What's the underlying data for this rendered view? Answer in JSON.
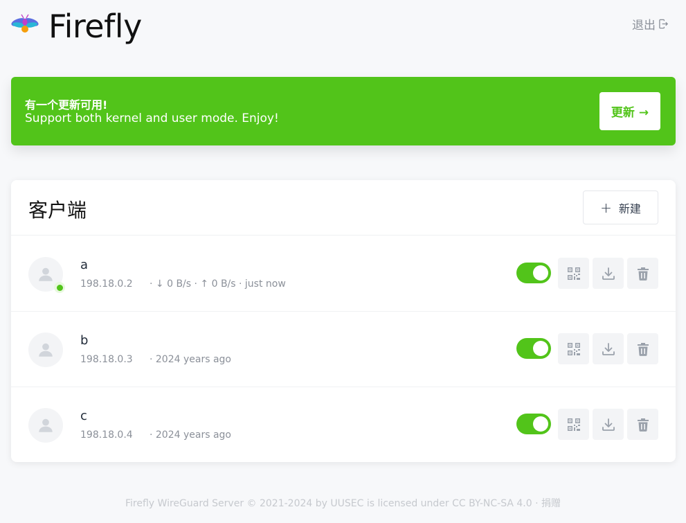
{
  "header": {
    "app_title": "Firefly",
    "logout_label": "退出"
  },
  "banner": {
    "title": "有一个更新可用!",
    "description": "Support both kernel and user mode. Enjoy!",
    "update_button": "更新 →"
  },
  "clients_section": {
    "title": "客户端",
    "new_button": "新建"
  },
  "clients": [
    {
      "name": "a",
      "ip": "198.18.0.2",
      "status": "· ↓ 0 B/s · ↑ 0 B/s · just now",
      "online": true,
      "enabled": true
    },
    {
      "name": "b",
      "ip": "198.18.0.3",
      "status": "· 2024 years ago",
      "online": false,
      "enabled": true
    },
    {
      "name": "c",
      "ip": "198.18.0.4",
      "status": "· 2024 years ago",
      "online": false,
      "enabled": true
    }
  ],
  "footer": {
    "text": "Firefly WireGuard Server © 2021-2024 by UUSEC is licensed under CC BY-NC-SA 4.0 · 捐赠"
  },
  "colors": {
    "accent": "#52c41a",
    "background": "#f7f8fa",
    "icon_gray": "#9aa1ab"
  },
  "icons": {
    "logo": "firefly-logo-icon",
    "logout": "logout-icon",
    "avatar": "user-avatar-icon",
    "qr": "qr-code-icon",
    "download": "download-icon",
    "delete": "trash-icon"
  }
}
